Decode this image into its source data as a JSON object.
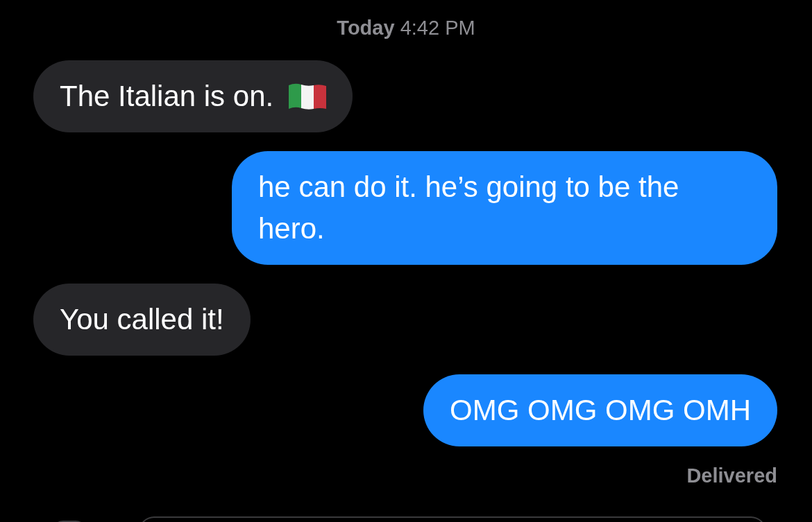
{
  "timestamp": "**Today** 4:42 PM",
  "messages": [
    {
      "text": "The Italian is on.",
      "kind": "incoming",
      "has_flag": true
    },
    {
      "text": "he can do it. he’s going to be the hero.",
      "kind": "outgoing",
      "has_flag": false
    },
    {
      "text": "You called it!",
      "kind": "incoming",
      "has_flag": false
    },
    {
      "text": "OMG OMG OMG OMH",
      "kind": "outgoing",
      "has_flag": false
    }
  ],
  "status": "Delivered"
}
